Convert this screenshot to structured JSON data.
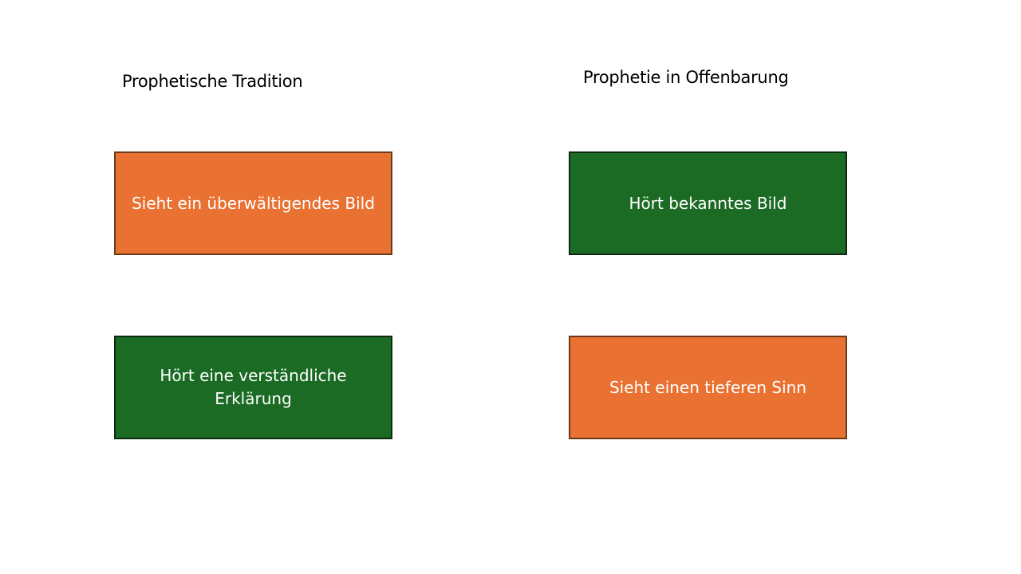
{
  "columns": {
    "left": {
      "heading": "Prophetische Tradition",
      "top_box": {
        "text": "Sieht ein überwältigendes Bild",
        "color": "#e97132"
      },
      "bottom_box": {
        "text": "Hört eine verständliche Erklärung",
        "color": "#1b6b24"
      }
    },
    "right": {
      "heading": "Prophetie in Offenbarung",
      "top_box": {
        "text": "Hört bekanntes Bild",
        "color": "#1b6b24"
      },
      "bottom_box": {
        "text": "Sieht einen tieferen Sinn",
        "color": "#e97132"
      }
    }
  }
}
